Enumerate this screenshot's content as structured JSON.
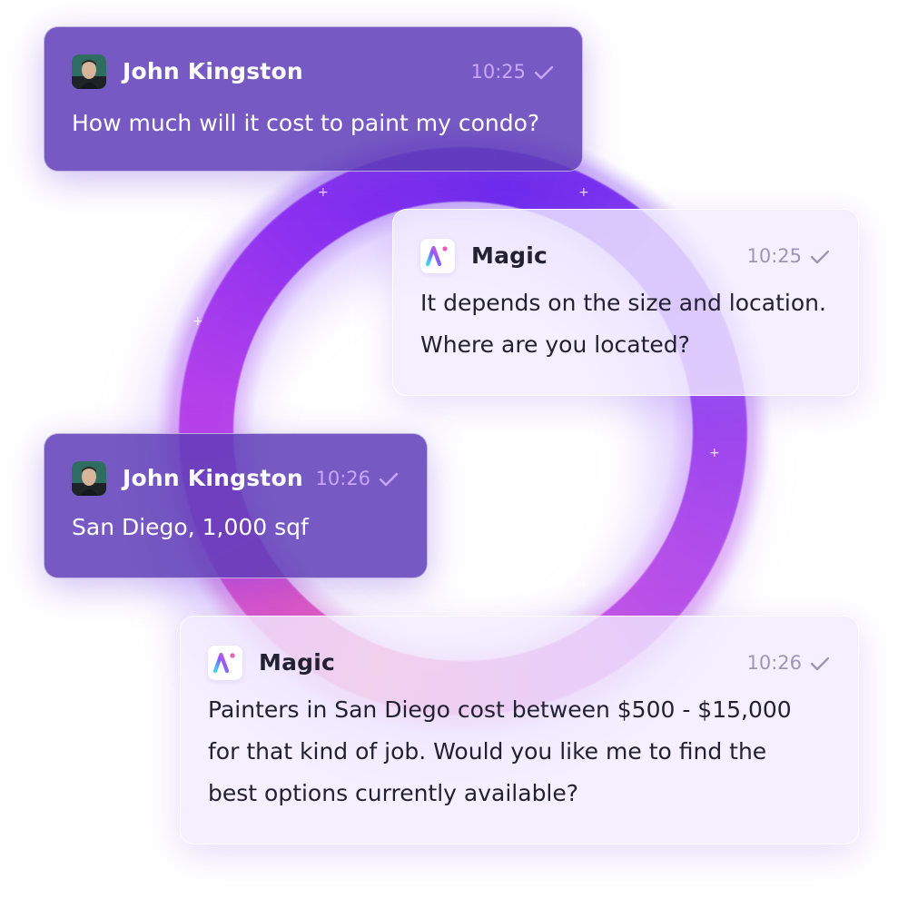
{
  "conversation": {
    "messages": [
      {
        "sender": "John Kingston",
        "role": "user",
        "time": "10:25",
        "status_icon": "check-icon",
        "text": "How much will it cost to paint my condo?"
      },
      {
        "sender": "Magic",
        "role": "assistant",
        "time": "10:25",
        "status_icon": "check-icon",
        "lines": [
          "It depends on the size and location.",
          "Where are you located?"
        ]
      },
      {
        "sender": "John Kingston",
        "role": "user",
        "time": "10:26",
        "status_icon": "check-icon",
        "text": "San Diego, 1,000 sqf"
      },
      {
        "sender": "Magic",
        "role": "assistant",
        "time": "10:26",
        "status_icon": "check-icon",
        "lines": [
          "Painters in San Diego cost between $500 - $15,000",
          "for that kind of job. Would you like me to find the",
          "best options currently available?"
        ]
      }
    ]
  },
  "theme": {
    "user_bubble": "#603EB8",
    "assistant_bubble": "#F1ECFF",
    "ring_gradient": [
      "#EE5DA8",
      "#C443E8",
      "#6A23EE"
    ],
    "user_time_color": "#C9A6FF",
    "assistant_time_color": "#9B97B4",
    "logo_gradient": [
      "#3DD6F5",
      "#8A5BFF",
      "#F25AB8"
    ]
  }
}
